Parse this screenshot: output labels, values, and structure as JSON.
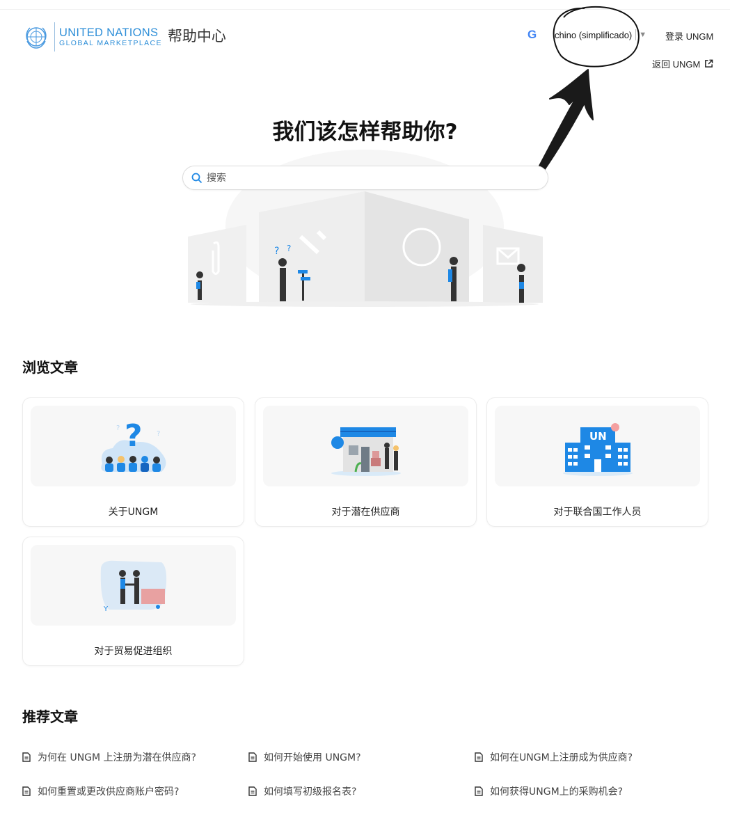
{
  "header": {
    "logo_line1": "UNITED NATIONS",
    "logo_line2": "GLOBAL MARKETPLACE",
    "help_title": "帮助中心",
    "language": {
      "selected": "chino (simplificado)",
      "icon": "google-translate-icon"
    },
    "login_label": "登录 UNGM",
    "back_label": "返回 UNGM"
  },
  "hero": {
    "title": "我们该怎样帮助你?",
    "search_placeholder": "搜索"
  },
  "browse": {
    "title": "浏览文章",
    "cards": [
      {
        "label": "关于UNGM",
        "icon": "question-people-illustration"
      },
      {
        "label": "对于潜在供应商",
        "icon": "shop-illustration"
      },
      {
        "label": "对于联合国工作人员",
        "icon": "un-building-illustration"
      },
      {
        "label": "对于贸易促进组织",
        "icon": "handshake-illustration"
      }
    ]
  },
  "recommended": {
    "title": "推荐文章",
    "articles": [
      "为何在 UNGM 上注册为潜在供应商?",
      "如何开始使用 UNGM?",
      "如何在UNGM上注册成为供应商?",
      "如何重置或更改供应商账户密码?",
      "如何填写初级报名表?",
      "如何获得UNGM上的采购机会?"
    ]
  },
  "colors": {
    "brand": "#2f8fd8",
    "accent": "#1e88e5",
    "annotation": "#222222"
  }
}
